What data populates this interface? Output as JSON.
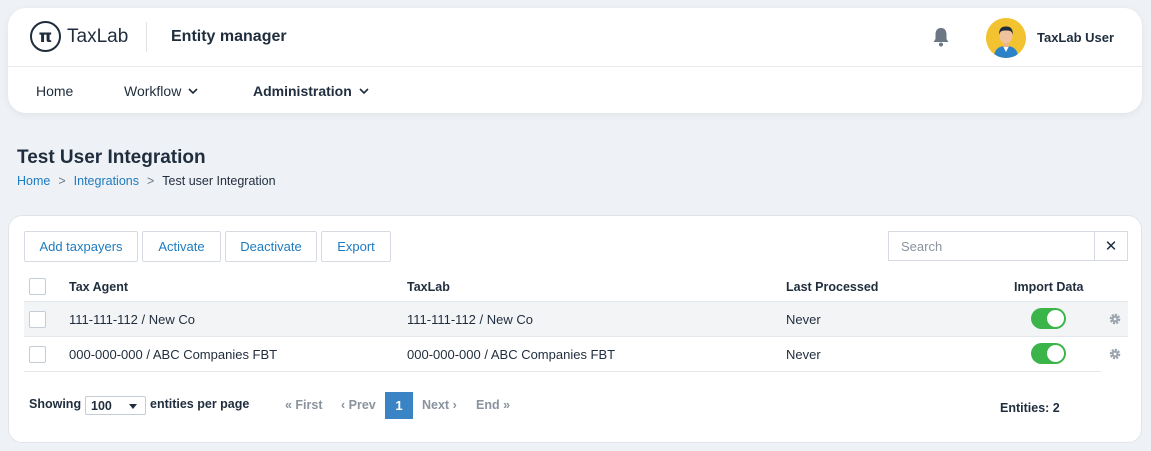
{
  "header": {
    "logo_symbol": "π",
    "logo_text": "TaxLab",
    "app_title": "Entity manager",
    "user_name": "TaxLab User",
    "notification_icon": "bell-icon",
    "avatar_color": "#f2c230"
  },
  "nav": {
    "items": [
      {
        "label": "Home"
      },
      {
        "label": "Workflow"
      },
      {
        "label": "Administration"
      }
    ]
  },
  "page": {
    "title": "Test User Integration",
    "breadcrumb": [
      "Home",
      "Integrations",
      "Test user Integration"
    ],
    "breadcrumb_sep": ">"
  },
  "toolbar": {
    "add_taxpayers": "Add taxpayers",
    "activate": "Activate",
    "deactivate": "Deactivate",
    "export": "Export",
    "search_placeholder": "Search",
    "clear_symbol": "✕"
  },
  "table": {
    "headers": [
      "Tax Agent",
      "TaxLab",
      "Last Processed",
      "Import Data"
    ],
    "rows": [
      {
        "tax_agent": "111-111-112 / New Co",
        "taxlab": "111-111-112 / New Co",
        "last_processed": "Never",
        "import_data": true
      },
      {
        "tax_agent": "000-000-000 / ABC Companies FBT",
        "taxlab": "000-000-000 / ABC Companies FBT",
        "last_processed": "Never",
        "import_data": true
      }
    ]
  },
  "pagination": {
    "showing_label": "Showing",
    "page_size": "100",
    "per_page_label": "entities per page",
    "first": "« First",
    "prev": "‹ Prev",
    "current": "1",
    "next": "Next ›",
    "end": "End »",
    "entities_count": "Entities: 2"
  },
  "colors": {
    "accent": "#1e7bbf",
    "toggle_on": "#3bb54a",
    "page_active": "#3a84c6"
  }
}
